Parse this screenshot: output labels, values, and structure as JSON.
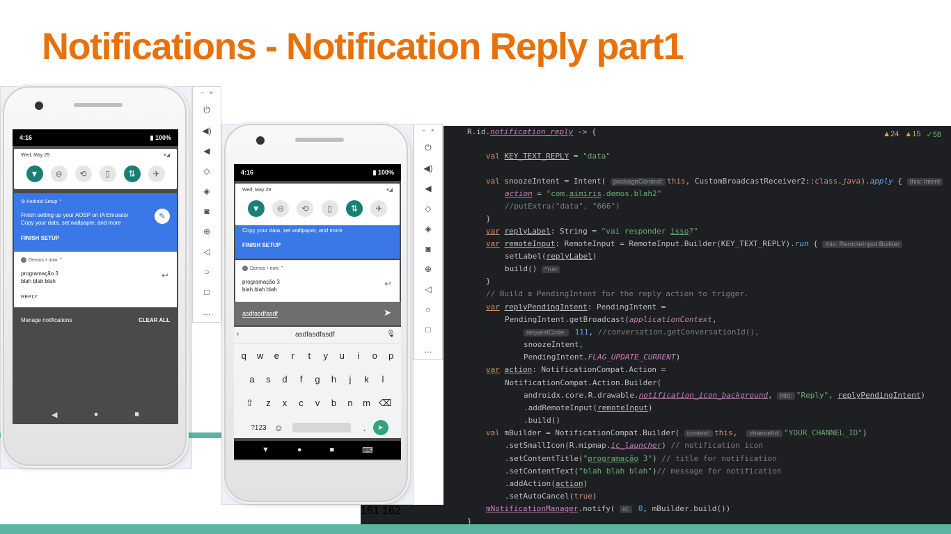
{
  "slide": {
    "title": "Notifications - Notification Reply part1"
  },
  "phone1": {
    "status": {
      "time": "4:16",
      "battery": "100%"
    },
    "qs": {
      "date": "Wed, May 29"
    },
    "setup": {
      "header": "Android Setup ⌃",
      "line1": "Finish setting up your AOSP on IA Emulator",
      "line2": "Copy your data, set wallpaper, and more",
      "action": "FINISH SETUP"
    },
    "notif": {
      "header": "Demos • now ⌃",
      "title": "programação 3",
      "text": "blah blah blah",
      "reply": "REPLY"
    },
    "footer": {
      "manage": "Manage notifications",
      "clear": "CLEAR ALL"
    }
  },
  "phone2": {
    "status": {
      "time": "4:16",
      "battery": "100%"
    },
    "qs": {
      "date": "Wed, May 29"
    },
    "setup": {
      "line2": "Copy your data, set wallpaper, and more",
      "action": "FINISH SETUP"
    },
    "notif": {
      "header": "Demos • now ⌃",
      "title": "programação 3",
      "text": "blah blah blah"
    },
    "reply_input": {
      "value": "asdfasdfasdf"
    },
    "keyboard": {
      "suggestion": "asdfasdfasdf",
      "row1": [
        "q",
        "w",
        "e",
        "r",
        "t",
        "y",
        "u",
        "i",
        "o",
        "p"
      ],
      "row2": [
        "a",
        "s",
        "d",
        "f",
        "g",
        "h",
        "j",
        "k",
        "l"
      ],
      "row3": [
        "z",
        "x",
        "c",
        "v",
        "b",
        "n",
        "m"
      ],
      "sym": "?123",
      "period": "."
    }
  },
  "editor": {
    "inspections": {
      "warnings": "24",
      "weak": "15",
      "ok": "58"
    },
    "line_numbers": [
      "161",
      "162"
    ]
  }
}
